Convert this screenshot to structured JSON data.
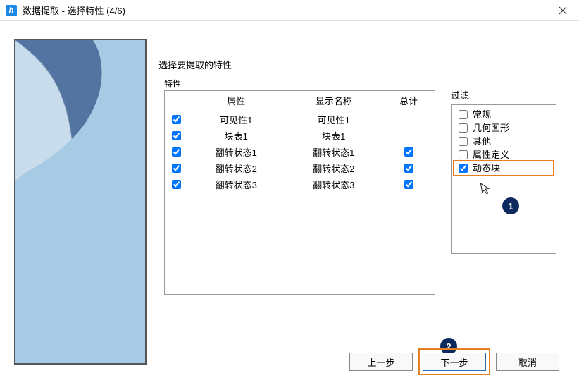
{
  "titlebar": {
    "app_icon_letter": "h",
    "title": "数据提取 - 选择特性 (4/6)"
  },
  "instruction": "选择要提取的特性",
  "props_group_label": "特性",
  "table": {
    "headers": {
      "attr": "属性",
      "display": "显示名称",
      "total": "总计"
    },
    "rows": [
      {
        "checked": true,
        "attr": "可见性1",
        "display": "可见性1",
        "has_total_cb": false
      },
      {
        "checked": true,
        "attr": "块表1",
        "display": "块表1",
        "has_total_cb": false
      },
      {
        "checked": true,
        "attr": "翻转状态1",
        "display": "翻转状态1",
        "has_total_cb": true,
        "total_checked": true
      },
      {
        "checked": true,
        "attr": "翻转状态2",
        "display": "翻转状态2",
        "has_total_cb": true,
        "total_checked": true
      },
      {
        "checked": true,
        "attr": "翻转状态3",
        "display": "翻转状态3",
        "has_total_cb": true,
        "total_checked": true
      }
    ]
  },
  "filter": {
    "label": "过滤",
    "items": [
      {
        "label": "常规",
        "checked": false,
        "highlight": false
      },
      {
        "label": "几何图形",
        "checked": false,
        "highlight": false
      },
      {
        "label": "其他",
        "checked": false,
        "highlight": false
      },
      {
        "label": "属性定义",
        "checked": false,
        "highlight": false
      },
      {
        "label": "动态块",
        "checked": true,
        "highlight": true
      }
    ]
  },
  "callouts": {
    "one": "1",
    "two": "2"
  },
  "buttons": {
    "prev": "上一步",
    "next": "下一步",
    "cancel": "取消"
  }
}
